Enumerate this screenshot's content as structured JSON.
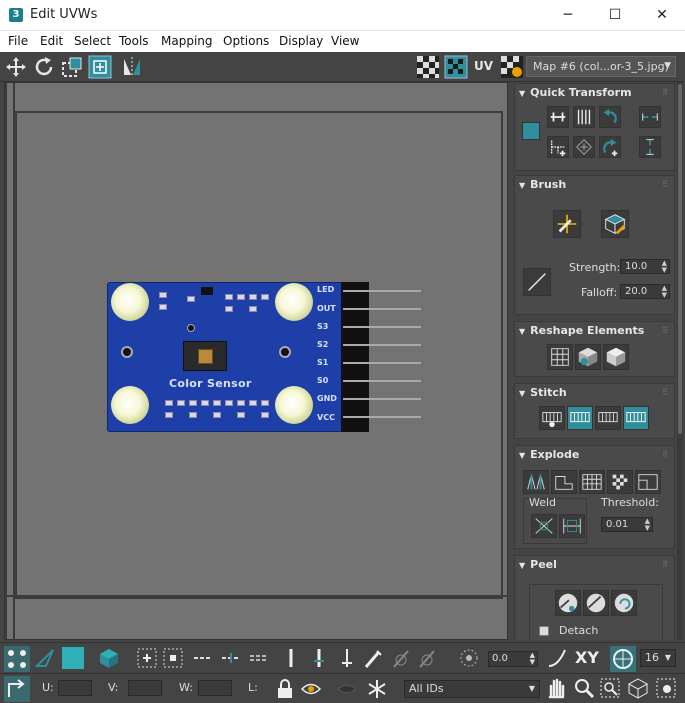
{
  "window": {
    "app_icon": "3",
    "title": "Edit UVWs",
    "minimize_glyph": "─",
    "maximize_glyph": "☐",
    "close_glyph": "✕"
  },
  "menu": [
    "File",
    "Edit",
    "Select",
    "Tools",
    "Mapping",
    "Options",
    "Display",
    "View"
  ],
  "toolbar_top": {
    "uv_label": "UV",
    "map_select": "Map #6 (col...or-3_5.jpg)"
  },
  "board": {
    "label": "Color Sensor",
    "pins": [
      "LED",
      "OUT",
      "S3",
      "S2",
      "S1",
      "S0",
      "GND",
      "VCC"
    ]
  },
  "panel": {
    "quick_transform": {
      "title": "Quick Transform"
    },
    "brush": {
      "title": "Brush",
      "strength_label": "Strength:",
      "strength_value": "10.0",
      "falloff_label": "Falloff:",
      "falloff_value": "20.0"
    },
    "reshape": {
      "title": "Reshape Elements"
    },
    "stitch": {
      "title": "Stitch"
    },
    "explode": {
      "title": "Explode",
      "weld_label": "Weld",
      "threshold_label": "Threshold:",
      "threshold_value": "0.01"
    },
    "peel": {
      "title": "Peel",
      "detach_label": "Detach"
    }
  },
  "bottom1": {
    "rotate_value": "0.0",
    "xy_label": "XY",
    "grid_value": "16"
  },
  "bottom2": {
    "u_label": "U:",
    "v_label": "V:",
    "w_label": "W:",
    "l_label": "L:",
    "ids_dropdown": "All IDs"
  },
  "colors": {
    "accent_teal": "#2f8f9c",
    "viewport_gray": "#737373",
    "board_blue": "#1e3fa8"
  }
}
